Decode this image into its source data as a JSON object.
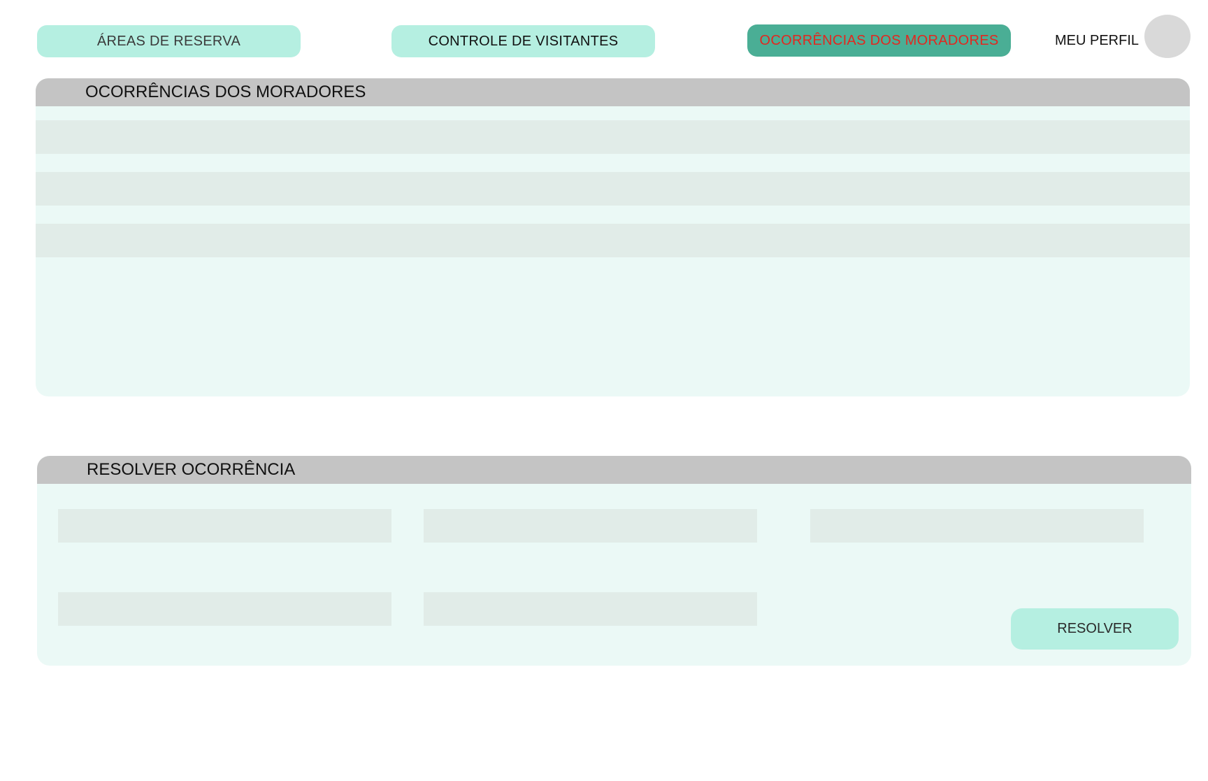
{
  "nav": {
    "areas_label": "ÁREAS DE RESERVA",
    "visitantes_label": "CONTROLE DE VISITANTES",
    "ocorrencias_label": "OCORRÊNCIAS DOS MORADORES",
    "active_tab": "OCORRÊNCIAS DOS MORADORES",
    "profile_label": "MEU PERFIL"
  },
  "occurrences_panel": {
    "title": "OCORRÊNCIAS DOS MORADORES",
    "rows": [
      "",
      "",
      ""
    ]
  },
  "resolve_panel": {
    "title": "RESOLVER OCORRÊNCIA",
    "fields": [
      "",
      "",
      "",
      "",
      ""
    ],
    "button_label": "RESOLVER"
  },
  "colors": {
    "nav_light": "#b5efe1",
    "nav_active": "#4aae95",
    "nav_active_text": "#e3271f",
    "panel_bg": "#ebf9f6",
    "panel_header": "#c4c4c4",
    "row_bg": "#e1ece8",
    "avatar": "#d9d9d9"
  },
  "icons": {
    "avatar": "profile-avatar-circle"
  }
}
